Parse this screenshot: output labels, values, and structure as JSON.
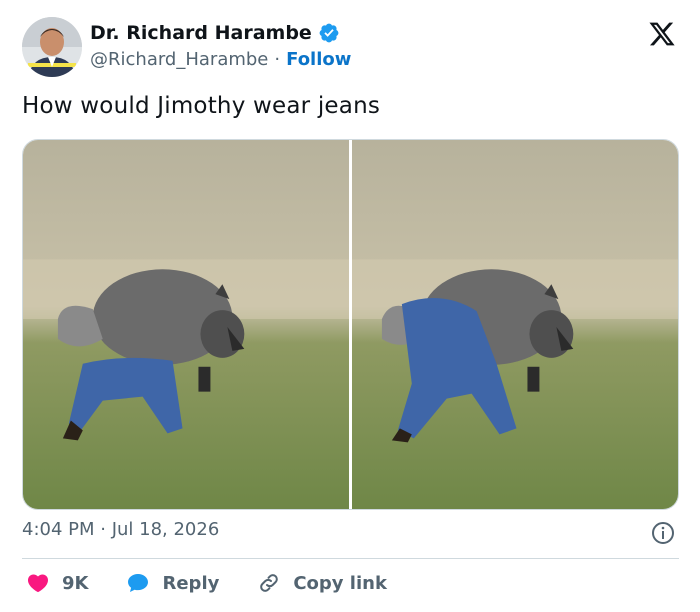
{
  "author": {
    "name": "Dr. Richard Harambe",
    "handle": "@Richard_Harambe",
    "separator": "·",
    "follow_label": "Follow"
  },
  "tweet": {
    "text": "How would Jimothy wear jeans",
    "timestamp": "4:04 PM · Jul 18, 2026"
  },
  "actions": {
    "like_count": "9K",
    "reply_label": "Reply",
    "copy_link_label": "Copy link"
  },
  "icons": [
    "verified-badge-icon",
    "x-logo-icon",
    "info-icon",
    "heart-icon",
    "reply-bubble-icon",
    "link-icon"
  ],
  "colors": {
    "accent": "#1d9bf0",
    "follow": "#0b74c9",
    "like": "#f91880",
    "secondary_text": "#536471",
    "border": "#cfd9de"
  }
}
